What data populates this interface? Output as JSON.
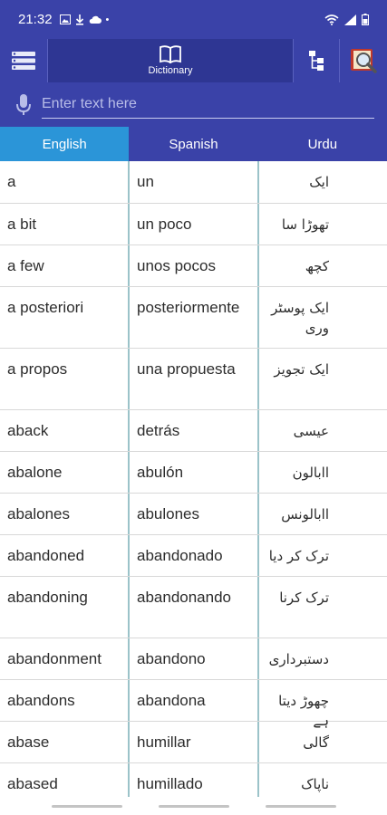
{
  "status": {
    "time": "21:32",
    "dot": "•"
  },
  "toolbar": {
    "title": "Dictionary"
  },
  "search": {
    "placeholder": "Enter text here",
    "value": ""
  },
  "tabs": [
    {
      "label": "English",
      "active": true
    },
    {
      "label": "Spanish",
      "active": false
    },
    {
      "label": "Urdu",
      "active": false
    }
  ],
  "rows": [
    {
      "en": "a",
      "es": "un",
      "ur": "ایک"
    },
    {
      "en": "a bit",
      "es": "un poco",
      "ur": "تھوڑا سا"
    },
    {
      "en": "a few",
      "es": "unos pocos",
      "ur": "کچھ"
    },
    {
      "en": "a posteriori",
      "es": "posteriormente",
      "ur": "ایک پوسٹروری"
    },
    {
      "en": "a propos",
      "es": "una propuesta",
      "ur": "ایک تجویز"
    },
    {
      "en": "aback",
      "es": "detrás",
      "ur": "عیسی"
    },
    {
      "en": "abalone",
      "es": "abulón",
      "ur": "اابالون"
    },
    {
      "en": "abalones",
      "es": "abulones",
      "ur": "اابالونس"
    },
    {
      "en": "abandoned",
      "es": "abandonado",
      "ur": "ترک کر دیا"
    },
    {
      "en": "abandoning",
      "es": "abandonando",
      "ur": "ترک کرنا"
    },
    {
      "en": "abandonment",
      "es": "abandono",
      "ur": "دستبرداری"
    },
    {
      "en": "abandons",
      "es": "abandona",
      "ur": "چھوڑ دیتا ہے"
    },
    {
      "en": "abase",
      "es": "humillar",
      "ur": "گالی"
    },
    {
      "en": "abased",
      "es": "humillado",
      "ur": "ناپاک"
    }
  ]
}
